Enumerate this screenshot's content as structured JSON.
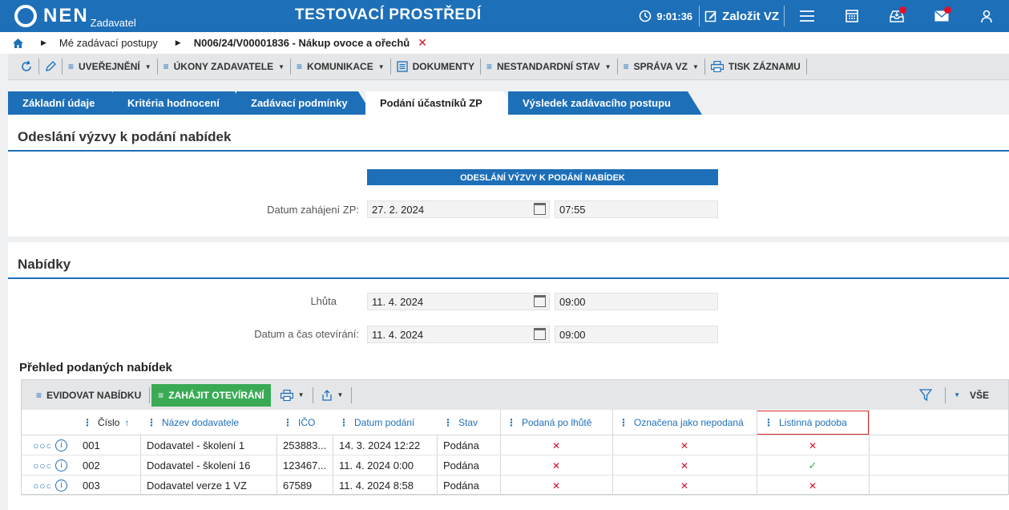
{
  "header": {
    "logo": "NEN",
    "logo_sub": "Zadavatel",
    "env_title": "TESTOVACÍ PROSTŘEDÍ",
    "clock": "9:01:36",
    "create_label": "Založit VZ"
  },
  "breadcrumb": {
    "items": [
      "Mé zadávací postupy",
      "N006/24/V00001836 - Nákup ovoce a ořechů"
    ]
  },
  "toolbar": {
    "items": [
      "UVEŘEJNĚNÍ",
      "ÚKONY ZADAVATELE",
      "KOMUNIKACE",
      "DOKUMENTY",
      "NESTANDARDNÍ STAV",
      "SPRÁVA VZ",
      "TISK ZÁZNAMU"
    ]
  },
  "tabs": [
    "Základní údaje",
    "Kritéria hodnocení",
    "Zadávací podmínky",
    "Podání účastníků ZP",
    "Výsledek zadávacího postupu"
  ],
  "section1": {
    "title": "Odeslání výzvy k podání nabídek",
    "box_header": "ODESLÁNÍ VÝZVY K PODÁNÍ NABÍDEK",
    "date_label": "Datum zahájení ZP:",
    "date_value": "27. 2. 2024",
    "time_value": "07:55"
  },
  "section2": {
    "title": "Nabídky",
    "deadline_label": "Lhůta",
    "deadline_date": "11. 4. 2024",
    "deadline_time": "09:00",
    "opening_label": "Datum a čas otevírání:",
    "opening_date": "11. 4. 2024",
    "opening_time": "09:00"
  },
  "grid": {
    "title": "Přehled podaných nabídek",
    "btn_record": "EVIDOVAT NABÍDKU",
    "btn_open": "ZAHÁJIT OTEVÍRÁNÍ",
    "filter_all": "VŠE",
    "columns": [
      "Číslo",
      "Název dodavatele",
      "IČO",
      "Datum podání",
      "Stav",
      "Podaná po lhůtě",
      "Označena jako nepodaná",
      "Listinná podoba"
    ],
    "sort_arrow": "↑",
    "rows": [
      {
        "cislo": "001",
        "nazev": "Dodavatel - školení 1",
        "ico": "253883...",
        "datum": "14. 3. 2024 12:22",
        "stav": "Podána",
        "po_lhute": "✕",
        "nepodana": "✕",
        "listinna": "✕"
      },
      {
        "cislo": "002",
        "nazev": "Dodavatel - školení 16",
        "ico": "123467...",
        "datum": "11. 4. 2024 0:00",
        "stav": "Podána",
        "po_lhute": "✕",
        "nepodana": "✕",
        "listinna": "✓"
      },
      {
        "cislo": "003",
        "nazev": "Dodavatel verze 1 VZ",
        "ico": "67589",
        "datum": "11. 4. 2024 8:58",
        "stav": "Podána",
        "po_lhute": "✕",
        "nepodana": "✕",
        "listinna": "✕"
      }
    ]
  },
  "colors": {
    "brand_blue": "#1d6fb8",
    "green": "#3aaa55",
    "red": "#d0102a"
  }
}
